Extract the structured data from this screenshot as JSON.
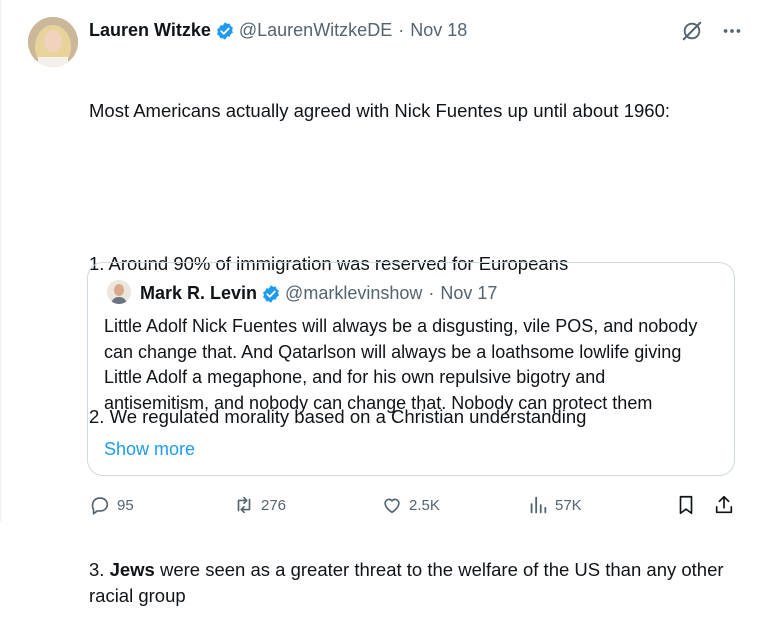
{
  "tweet": {
    "author_name": "Lauren Witzke",
    "author_handle": "@LaurenWitzkeDE",
    "separator": "·",
    "date": "Nov 18",
    "line1": "Most Americans actually agreed with Nick Fuentes up until about 1960:",
    "line2": "1. Around 90% of immigration was reserved for Europeans",
    "line3": "2. We regulated morality based on a Christian understanding",
    "line4_prefix": "3. ",
    "line4_bold": "Jews",
    "line4_rest": " were seen as a greater threat to the welfare of the US than any other racial group"
  },
  "quote": {
    "author_name": "Mark R. Levin",
    "author_handle": "@marklevinshow",
    "separator": "·",
    "date": "Nov 17",
    "text": "Little Adolf Nick Fuentes will always be a disgusting, vile POS, and nobody can change that.  And Qatarlson will always be a loathsome lowlife giving Little Adolf a megaphone, and for his own repulsive bigotry and antisemitism, and nobody can change that.  Nobody can protect them",
    "show_more": "Show more"
  },
  "actions": {
    "replies": "95",
    "reposts": "276",
    "likes": "2.5K",
    "views": "57K"
  },
  "colors": {
    "verified": "#1d9bf0",
    "secondary_text": "#536471",
    "link": "#1d9bf0",
    "border": "#cfd9de"
  },
  "icons": [
    "verified-badge-icon",
    "grok-icon",
    "more-icon",
    "reply-icon",
    "repost-icon",
    "like-icon",
    "views-icon",
    "bookmark-icon",
    "share-icon"
  ]
}
